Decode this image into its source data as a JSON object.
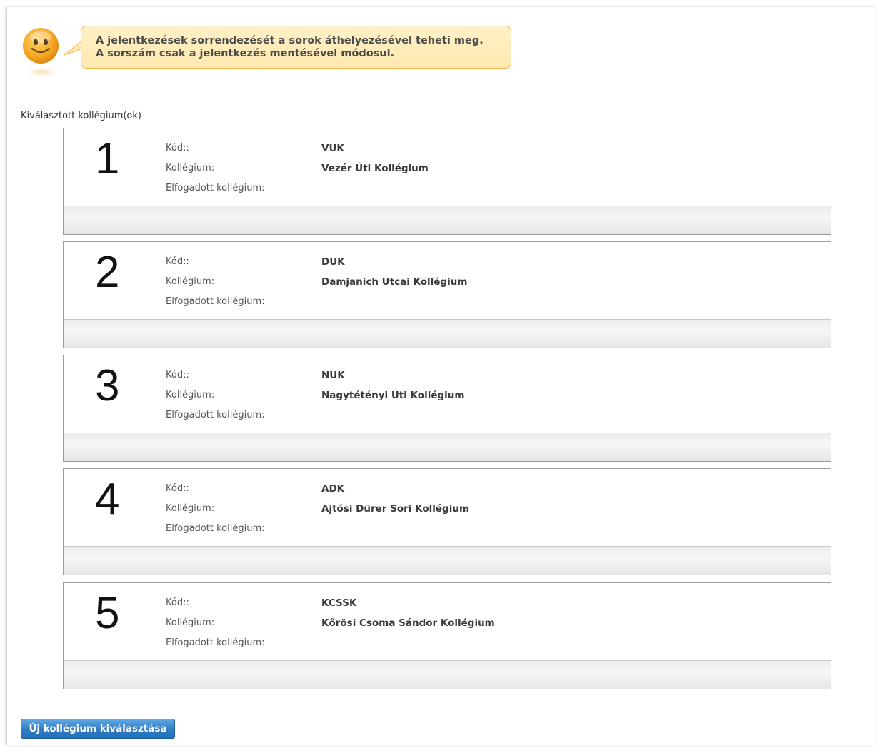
{
  "tip": {
    "line1": "A jelentkezések sorrendezését a sorok áthelyezésével teheti meg.",
    "line2": "A sorszám csak a jelentkezés mentésével módosul."
  },
  "section_label": "Kiválasztott kollégium(ok)",
  "field_labels": {
    "code": "Kód::",
    "college": "Kollégium:",
    "accepted": "Elfogadott kollégium:"
  },
  "cards": [
    {
      "number": "1",
      "code": "VUK",
      "college": "Vezér Úti Kollégium",
      "accepted": ""
    },
    {
      "number": "2",
      "code": "DUK",
      "college": "Damjanich Utcai Kollégium",
      "accepted": ""
    },
    {
      "number": "3",
      "code": "NUK",
      "college": "Nagytétényi Úti Kollégium",
      "accepted": ""
    },
    {
      "number": "4",
      "code": "ADK",
      "college": "Ajtósi Dürer Sori Kollégium",
      "accepted": ""
    },
    {
      "number": "5",
      "code": "KCSSK",
      "college": "Kőrösi Csoma Sándor Kollégium",
      "accepted": ""
    }
  ],
  "buttons": {
    "new_college": "Új kollégium kiválasztása"
  },
  "colors": {
    "bubble_fill": "#fee9b0",
    "bubble_border": "#f2b94a",
    "button_blue": "#2e7cc6"
  },
  "icons": {
    "tip": "smiley-icon"
  }
}
